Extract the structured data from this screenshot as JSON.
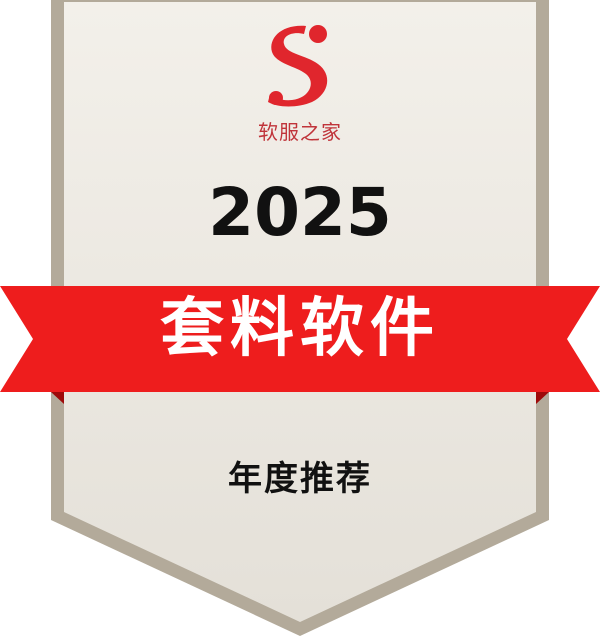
{
  "badge": {
    "brand_name": "软服之家",
    "year": "2025",
    "ribbon_label": "套料软件",
    "subtitle": "年度推荐"
  },
  "colors": {
    "shield_fill": "#eeeae1",
    "shield_border": "#b3aa9a",
    "ribbon_red": "#ee1d1d",
    "ribbon_dark": "#9e0a0a",
    "logo_red": "#e0262d",
    "brand_text": "#c0343a"
  },
  "icons": {
    "logo": "s-logo-icon"
  }
}
